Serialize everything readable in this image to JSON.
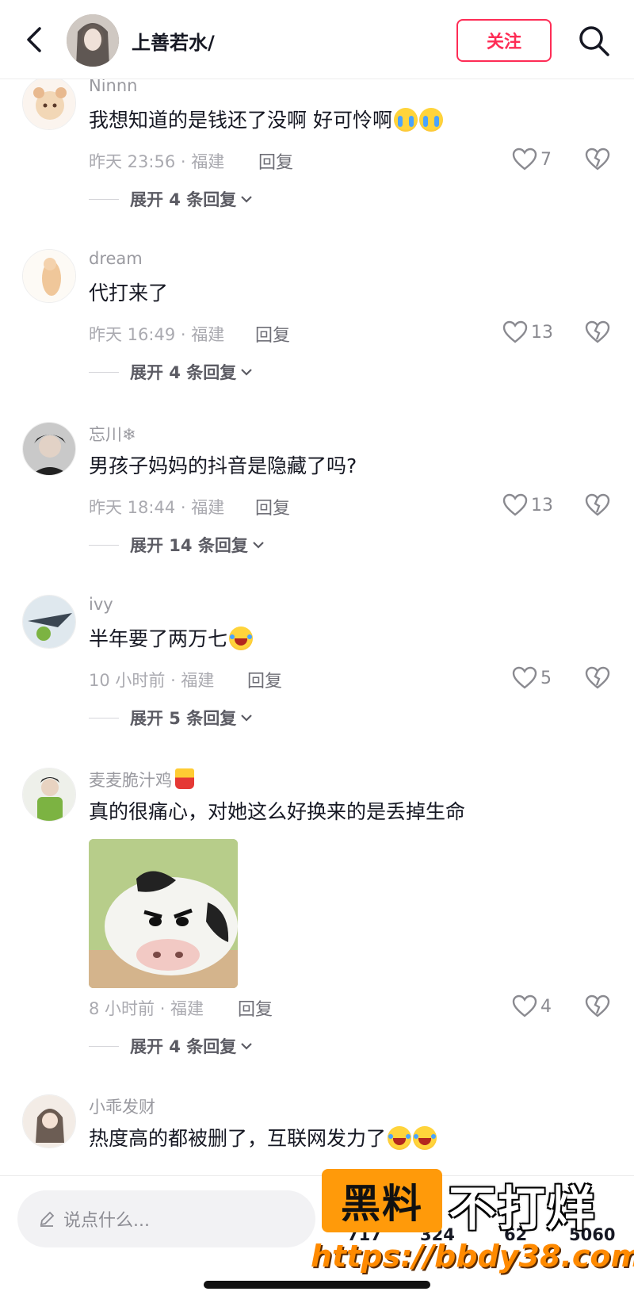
{
  "header": {
    "name": "上善若水/",
    "follow_label": "关注"
  },
  "comments": [
    {
      "user": "Ninnn",
      "text": "我想知道的是钱还了没啊 好可怜啊",
      "emojis": [
        "cry-emoji",
        "cry-emoji"
      ],
      "time": "昨天 23:56 · 福建",
      "reply_label": "回复",
      "likes": "7",
      "expand": "展开 4 条回复"
    },
    {
      "user": "dream",
      "text": "代打来了",
      "time": "昨天 16:49 · 福建",
      "reply_label": "回复",
      "likes": "13",
      "expand": "展开 4 条回复"
    },
    {
      "user": "忘川❄",
      "text": "男孩子妈妈的抖音是隐藏了吗?",
      "time": "昨天 18:44 · 福建",
      "reply_label": "回复",
      "likes": "13",
      "expand": "展开 14 条回复"
    },
    {
      "user": "ivy",
      "text": "半年要了两万七",
      "emojis": [
        "laugh-cry-emoji"
      ],
      "time": "10 小时前 · 福建",
      "reply_label": "回复",
      "likes": "5",
      "expand": "展开 5 条回复"
    },
    {
      "user": "麦麦脆汁鸡",
      "user_emoji": "fries-emoji",
      "text": "真的很痛心，对她这么好换来的是丢掉生命",
      "sticker": "angry-cow-sticker",
      "time": "8 小时前 · 福建",
      "reply_label": "回复",
      "likes": "4",
      "expand": "展开 4 条回复"
    },
    {
      "user": "小乖发财",
      "text": "热度高的都被删了，互联网发力了",
      "emojis": [
        "laugh-cry-emoji",
        "laugh-cry-emoji"
      ]
    }
  ],
  "bottom_bar": {
    "input_placeholder": "说点什么...",
    "stats": [
      "717",
      "324",
      "62",
      "5060"
    ]
  },
  "watermark": {
    "box_text": "黑料",
    "main_text": "不打烊",
    "url": "https://bbdy38.com"
  },
  "colors": {
    "accent": "#fe2c55",
    "watermark_orange": "#ff9a0a",
    "text_primary": "#161823",
    "text_secondary": "#9a9aa0"
  }
}
